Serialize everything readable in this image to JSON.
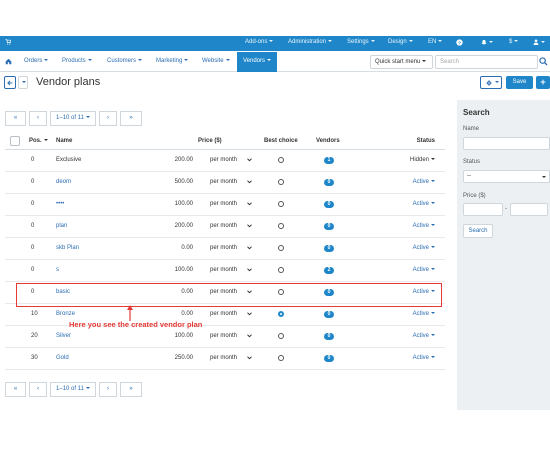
{
  "topbar": {
    "menus": [
      "Add-ons",
      "Administration",
      "Settings",
      "Design",
      "EN"
    ],
    "currency": "$",
    "icons": [
      "cart-icon",
      "help-icon",
      "bell-icon",
      "user-icon"
    ]
  },
  "navbar": {
    "items": [
      "Orders",
      "Products",
      "Customers",
      "Marketing",
      "Website",
      "Vendors"
    ],
    "active": "Vendors",
    "quick_start": "Quick start menu",
    "search_placeholder": "Search"
  },
  "page": {
    "title": "Vendor plans",
    "save_label": "Save",
    "add_label": "+"
  },
  "pagination": {
    "first": "«",
    "prev": "‹",
    "range": "1–10 of 11",
    "next": "›",
    "last": "»"
  },
  "table": {
    "headers": {
      "pos": "Pos.",
      "name": "Name",
      "price": "Price ($)",
      "best": "Best choice",
      "vendors": "Vendors",
      "status": "Status"
    },
    "rows": [
      {
        "pos": "0",
        "name": "Exclusive",
        "price": "200.00",
        "period": "per month",
        "best": false,
        "vendors": "1",
        "status": "Hidden"
      },
      {
        "pos": "0",
        "name": "deom",
        "price": "500.00",
        "period": "per month",
        "best": false,
        "vendors": "0",
        "status": "Active"
      },
      {
        "pos": "0",
        "name": "••••",
        "price": "100.00",
        "period": "per month",
        "best": false,
        "vendors": "0",
        "status": "Active"
      },
      {
        "pos": "0",
        "name": "plan",
        "price": "200.00",
        "period": "per month",
        "best": false,
        "vendors": "0",
        "status": "Active"
      },
      {
        "pos": "0",
        "name": "skb Plan",
        "price": "0.00",
        "period": "per month",
        "best": false,
        "vendors": "0",
        "status": "Active"
      },
      {
        "pos": "0",
        "name": "s",
        "price": "100.00",
        "period": "per month",
        "best": false,
        "vendors": "2",
        "status": "Active"
      },
      {
        "pos": "0",
        "name": "basic",
        "price": "0.00",
        "period": "per month",
        "best": false,
        "vendors": "0",
        "status": "Active"
      },
      {
        "pos": "10",
        "name": "Bronze",
        "price": "0.00",
        "period": "per month",
        "best": true,
        "vendors": "0",
        "status": "Active"
      },
      {
        "pos": "20",
        "name": "Silver",
        "price": "100.00",
        "period": "per month",
        "best": false,
        "vendors": "0",
        "status": "Active"
      },
      {
        "pos": "30",
        "name": "Gold",
        "price": "250.00",
        "period": "per month",
        "best": false,
        "vendors": "0",
        "status": "Active"
      }
    ]
  },
  "annotation": {
    "text": "Here you see the created vendor plan",
    "color": "#e53935"
  },
  "search_panel": {
    "title": "Search",
    "name_label": "Name",
    "name_value": "",
    "status_label": "Status",
    "status_value": "--",
    "price_label": "Price ($)",
    "price_separator": "-",
    "button_label": "Search"
  },
  "colors": {
    "primary": "#1f87c9",
    "link": "#2a6db3",
    "panel": "#edf0f2"
  }
}
